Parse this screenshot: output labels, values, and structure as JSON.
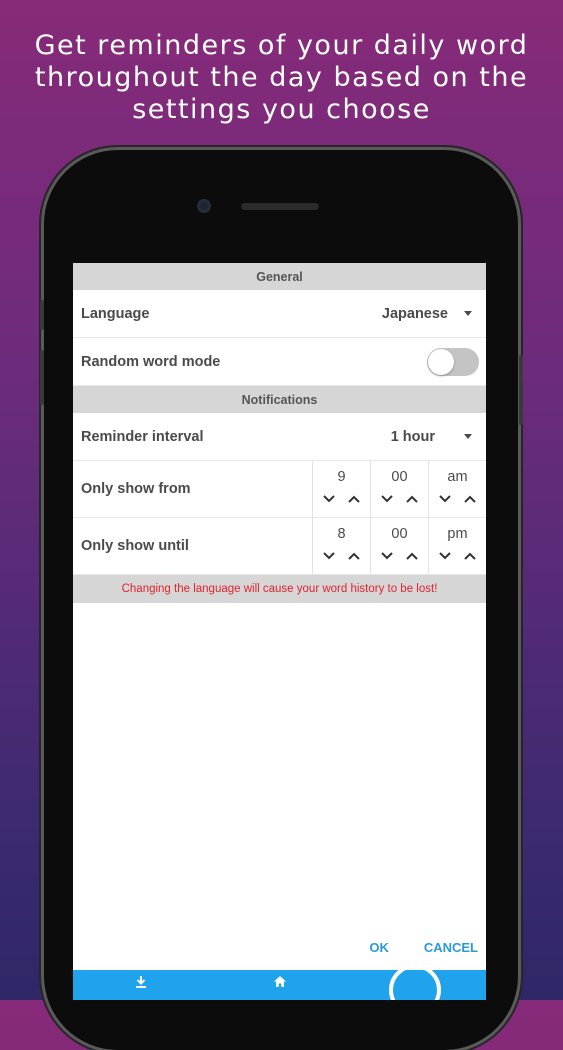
{
  "promo": {
    "line1": "Get reminders of your daily word",
    "line2": "throughout the day based on the",
    "line3": "settings you choose"
  },
  "settings": {
    "general_header": "General",
    "language_label": "Language",
    "language_value": "Japanese",
    "random_mode_label": "Random word mode",
    "random_mode_on": false,
    "notifications_header": "Notifications",
    "interval_label": "Reminder interval",
    "interval_value": "1 hour",
    "from_label": "Only show from",
    "from_time": {
      "hour": "9",
      "minute": "00",
      "period": "am"
    },
    "until_label": "Only show until",
    "until_time": {
      "hour": "8",
      "minute": "00",
      "period": "pm"
    },
    "warning": "Changing the language will cause your word history to be lost!"
  },
  "dialog": {
    "ok": "OK",
    "cancel": "CANCEL"
  },
  "colors": {
    "accent": "#2a9ad9",
    "bar": "#1fa3ec",
    "warning": "#e0232f",
    "header_bg": "#d6d6d6"
  },
  "bottom_nav": [
    "download-icon",
    "home-icon"
  ]
}
